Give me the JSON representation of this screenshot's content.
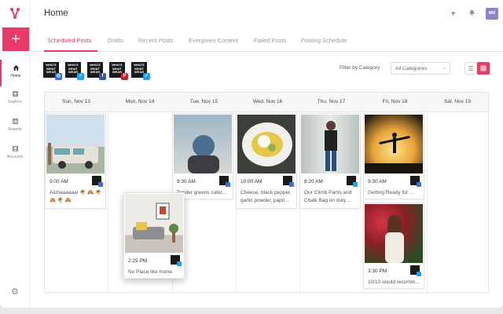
{
  "header": {
    "title": "Home",
    "avatar_initials": "MR"
  },
  "tabs": [
    "Scheduled Posts",
    "Drafts",
    "Recent Posts",
    "Evergreen Content",
    "Failed Posts",
    "Posting Schedule"
  ],
  "sidebar": {
    "items": [
      {
        "label": "Home",
        "icon": "home-icon"
      },
      {
        "label": "Explore",
        "icon": "explore-icon"
      },
      {
        "label": "Reports",
        "icon": "reports-icon"
      },
      {
        "label": "Accounts",
        "icon": "accounts-icon"
      }
    ]
  },
  "account_logo_text": "WHO'S WHAT WEAR",
  "accounts": [
    {
      "network": "instagram",
      "color": "#3d6fd8",
      "glyph": "◎"
    },
    {
      "network": "twitter",
      "color": "#1da1f2",
      "glyph": "✓"
    },
    {
      "network": "facebook",
      "color": "#3b5998",
      "glyph": "f"
    },
    {
      "network": "pinterest",
      "color": "#cb2027",
      "glyph": "P"
    },
    {
      "network": "twitter",
      "color": "#1da1f2",
      "glyph": "✓"
    }
  ],
  "filter": {
    "label": "Filter by Category",
    "value": "All Categories"
  },
  "days": [
    "Sun, Nov 13",
    "Mon, Nov 14",
    "Tue, Nov 15",
    "Wed, Nov 16",
    "Thu, Nov 17",
    "Fri, Nov 18",
    "Sat, Nov 19"
  ],
  "posts": [
    {
      "time": "9:00 AM",
      "caption": "Alohaaaaaa! 🌴 🙈 🌴 🙈 🌴 🙈",
      "net_color": "#3d6fd8"
    },
    {
      "time": "9:30 AM",
      "caption": "Tender greens cater...",
      "net_color": "#3d6fd8"
    },
    {
      "time": "10:00 AM",
      "caption": "Cheese, black pepper, garlic powder, papri...",
      "net_color": "#3d6fd8"
    },
    {
      "time": "8:20 AM",
      "caption": "Our Climb Pants and Chalk Bag on duty ...",
      "net_color": "#1da1f2"
    },
    {
      "time": "9:30 AM",
      "caption": "Getting Ready for ...",
      "net_color": "#3d6fd8"
    },
    {
      "time": "3:30 PM",
      "caption": "10/10 would recomm...",
      "net_color": "#1da1f2"
    },
    {
      "time": "2:25 PM",
      "caption": "No Place like home.",
      "net_color": "#1da1f2"
    }
  ]
}
